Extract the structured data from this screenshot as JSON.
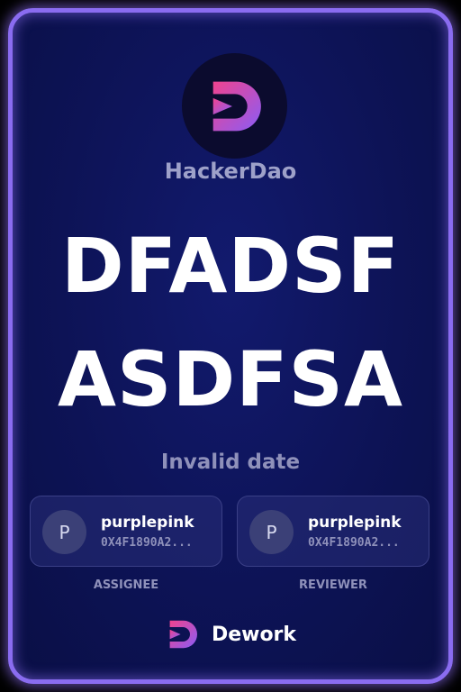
{
  "organization": {
    "name": "HackerDao",
    "logo_icon": "hackerdao-logo-icon"
  },
  "task": {
    "title_line1": "DFADSF",
    "title_line2": "ASDFSA",
    "date": "Invalid date"
  },
  "assignee": {
    "avatar_letter": "P",
    "name": "purplepink",
    "address": "0X4F1890A2...",
    "role": "ASSIGNEE"
  },
  "reviewer": {
    "avatar_letter": "P",
    "name": "purplepink",
    "address": "0X4F1890A2...",
    "role": "REVIEWER"
  },
  "footer": {
    "brand": "Dework",
    "logo_icon": "dework-logo-icon"
  },
  "colors": {
    "border": "#8a6cf0",
    "background": "#0d1356",
    "logo_gradient_start": "#e9418e",
    "logo_gradient_end": "#8a5cf6"
  }
}
